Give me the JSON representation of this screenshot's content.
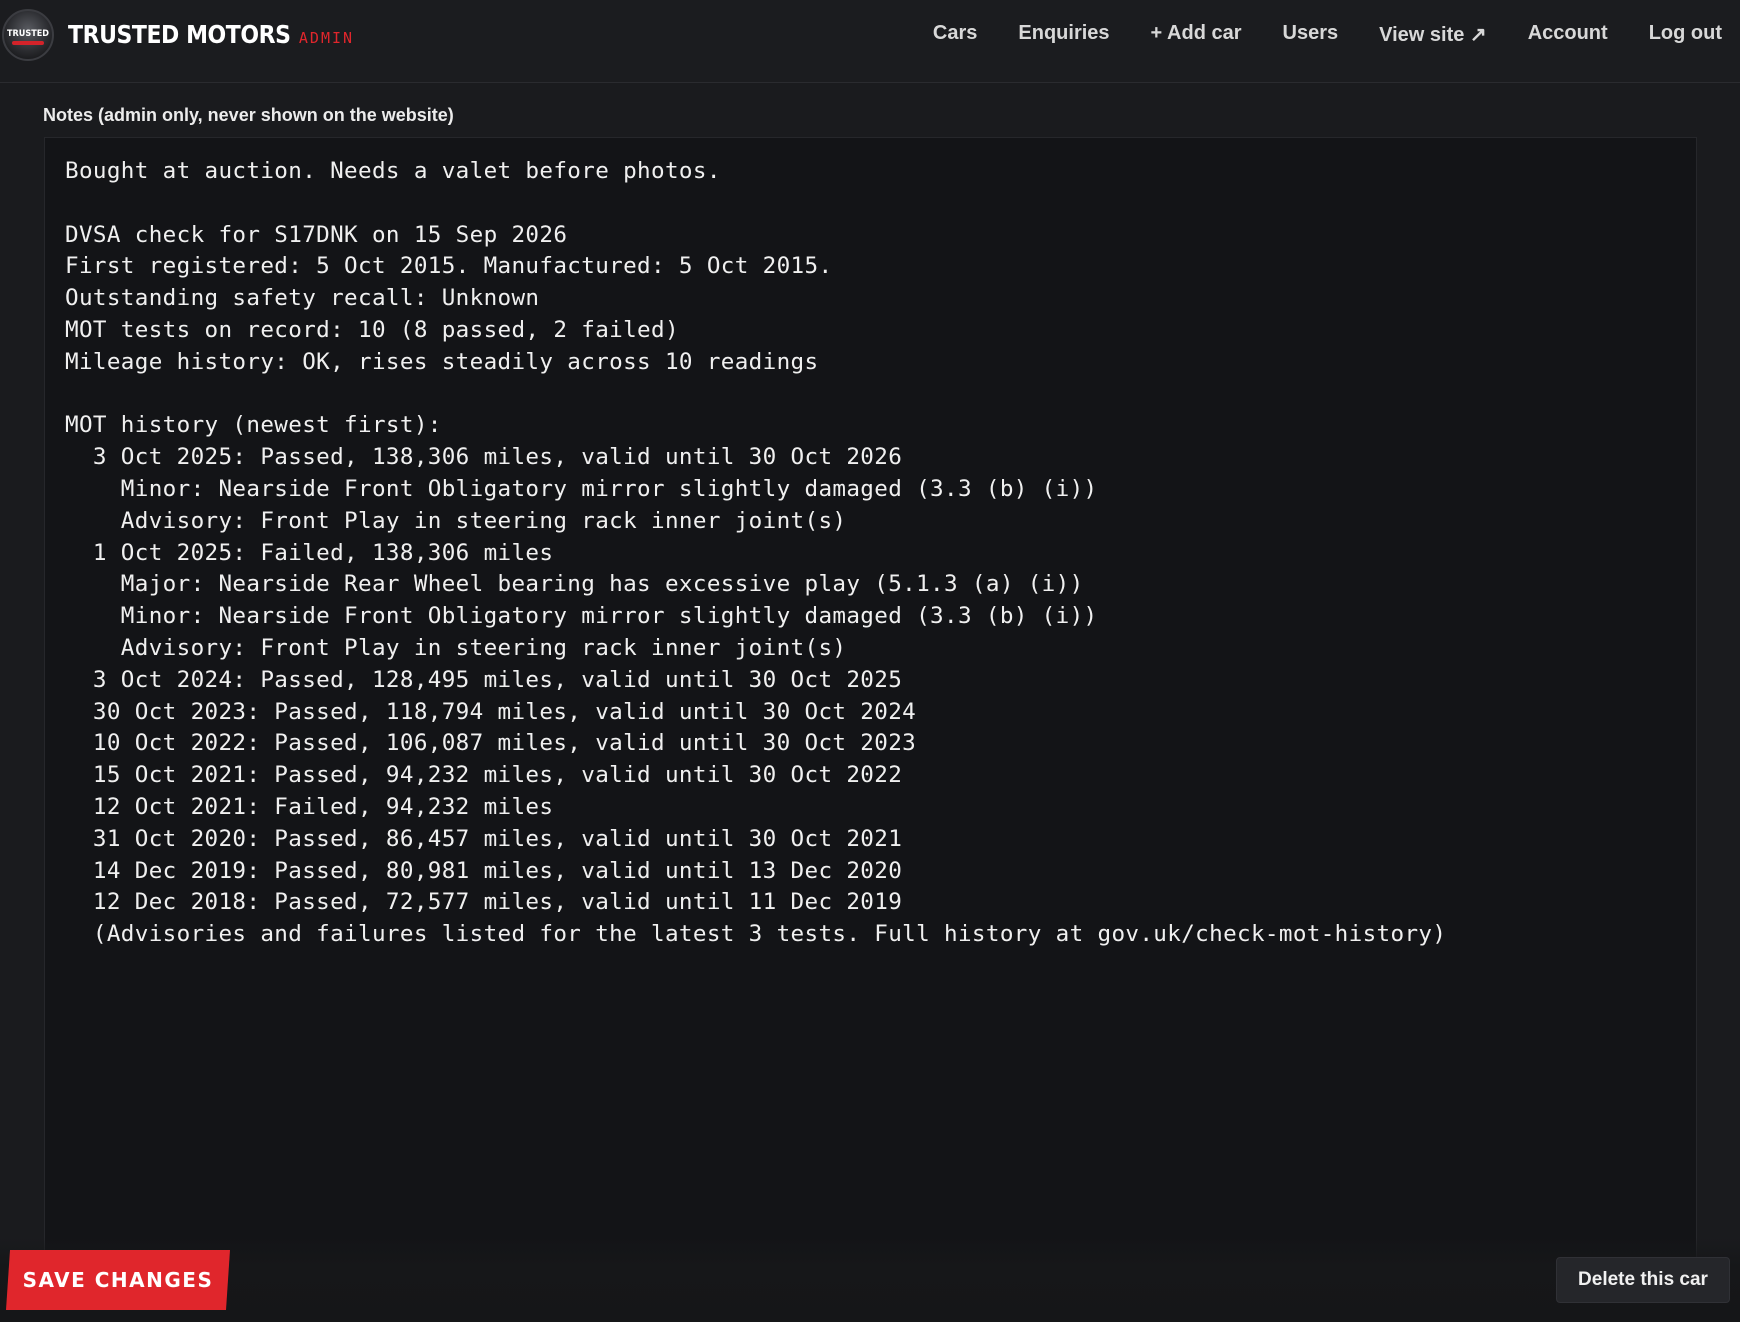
{
  "brand": {
    "logo_text": "TRUSTED",
    "name": "TRUSTED MOTORS",
    "tag": "ADMIN"
  },
  "nav": {
    "items": [
      {
        "label": "Cars"
      },
      {
        "label": "Enquiries"
      },
      {
        "label": "+ Add car"
      },
      {
        "label": "Users"
      },
      {
        "label": "View site ↗"
      },
      {
        "label": "Account"
      },
      {
        "label": "Log out"
      }
    ]
  },
  "notes": {
    "label": "Notes (admin only, never shown on the website)",
    "value": "Bought at auction. Needs a valet before photos.\n\nDVSA check for S17DNK on 15 Sep 2026\nFirst registered: 5 Oct 2015. Manufactured: 5 Oct 2015.\nOutstanding safety recall: Unknown\nMOT tests on record: 10 (8 passed, 2 failed)\nMileage history: OK, rises steadily across 10 readings\n\nMOT history (newest first):\n  3 Oct 2025: Passed, 138,306 miles, valid until 30 Oct 2026\n    Minor: Nearside Front Obligatory mirror slightly damaged (3.3 (b) (i))\n    Advisory: Front Play in steering rack inner joint(s)\n  1 Oct 2025: Failed, 138,306 miles\n    Major: Nearside Rear Wheel bearing has excessive play (5.1.3 (a) (i))\n    Minor: Nearside Front Obligatory mirror slightly damaged (3.3 (b) (i))\n    Advisory: Front Play in steering rack inner joint(s)\n  3 Oct 2024: Passed, 128,495 miles, valid until 30 Oct 2025\n  30 Oct 2023: Passed, 118,794 miles, valid until 30 Oct 2024\n  10 Oct 2022: Passed, 106,087 miles, valid until 30 Oct 2023\n  15 Oct 2021: Passed, 94,232 miles, valid until 30 Oct 2022\n  12 Oct 2021: Failed, 94,232 miles\n  31 Oct 2020: Passed, 86,457 miles, valid until 30 Oct 2021\n  14 Dec 2019: Passed, 80,981 miles, valid until 13 Dec 2020\n  12 Dec 2018: Passed, 72,577 miles, valid until 11 Dec 2019\n  (Advisories and failures listed for the latest 3 tests. Full history at gov.uk/check-mot-history)"
  },
  "actions": {
    "save_label": "SAVE CHANGES",
    "delete_label": "Delete this car"
  },
  "colors": {
    "accent": "#e0262c",
    "background": "#1a1b1e",
    "textarea_bg": "#131417"
  }
}
